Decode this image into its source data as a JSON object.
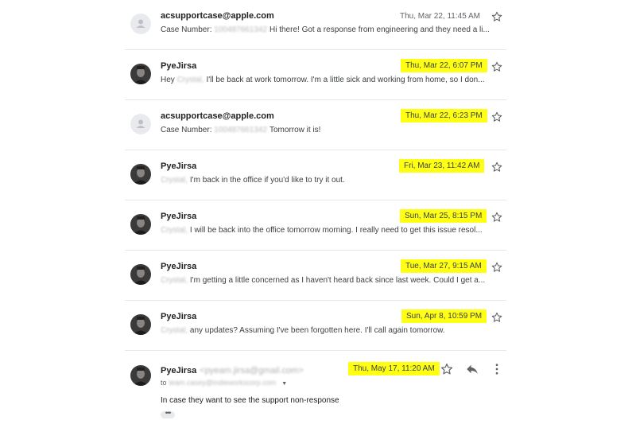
{
  "messages": [
    {
      "sender": "acsupportcase@apple.com",
      "avatar": "generic-person-icon",
      "redacted_prefix": "Case Number:",
      "redacted_text": "100487661342",
      "snippet": "Hi there! Got a response from engineering and they need a li...",
      "date": "Thu, Mar 22, 11:45 AM",
      "highlighted": false
    },
    {
      "sender": "PyeJirsa",
      "avatar": "profile-photo",
      "redacted_prefix": "Hey",
      "redacted_text": "Crystal,",
      "snippet": "I'll be back at work tomorrow. I'm a little sick and working from home, so I don...",
      "date": "Thu, Mar 22, 6:07 PM",
      "highlighted": true
    },
    {
      "sender": "acsupportcase@apple.com",
      "avatar": "generic-person-icon",
      "redacted_prefix": "Case Number:",
      "redacted_text": "100487661342",
      "snippet": "Tomorrow it is!",
      "date": "Thu, Mar 22, 6:23 PM",
      "highlighted": true
    },
    {
      "sender": "PyeJirsa",
      "avatar": "profile-photo",
      "redacted_prefix": "",
      "redacted_text": "Crystal,",
      "snippet": "I'm back in the office if you'd like to try it out.",
      "date": "Fri, Mar 23, 11:42 AM",
      "highlighted": true
    },
    {
      "sender": "PyeJirsa",
      "avatar": "profile-photo",
      "redacted_prefix": "",
      "redacted_text": "Crystal,",
      "snippet": "I will be back into the office tomorrow morning. I really need to get this issue resol...",
      "date": "Sun, Mar 25, 8:15 PM",
      "highlighted": true
    },
    {
      "sender": "PyeJirsa",
      "avatar": "profile-photo",
      "redacted_prefix": "",
      "redacted_text": "Crystal,",
      "snippet": "I'm getting a little concerned as I haven't heard back since last week. Could I get a...",
      "date": "Tue, Mar 27, 9:15 AM",
      "highlighted": true
    },
    {
      "sender": "PyeJirsa",
      "avatar": "profile-photo",
      "redacted_prefix": "",
      "redacted_text": "Crystal,",
      "snippet": "any updates? Assuming I've been forgotten here. I'll call again tomorrow.",
      "date": "Sun, Apr 8, 10:59 PM",
      "highlighted": true
    }
  ],
  "expanded": {
    "sender": "PyeJirsa",
    "sender_email": "<pyeam.jirsa@gmail.com>",
    "to_label": "to",
    "to_value": "team.casey@indieworkscorp.com",
    "date": "Thu, May 17, 11:20 AM",
    "body": "In case they want to see the support non-response",
    "show_trimmed": "•••"
  },
  "colors": {
    "highlight": "#ffff14",
    "divider": "#e6e6e6",
    "muted": "#5f6368"
  },
  "icons": {
    "star": "star-outline-icon",
    "reply": "reply-arrow-icon",
    "more": "more-vert-icon"
  }
}
